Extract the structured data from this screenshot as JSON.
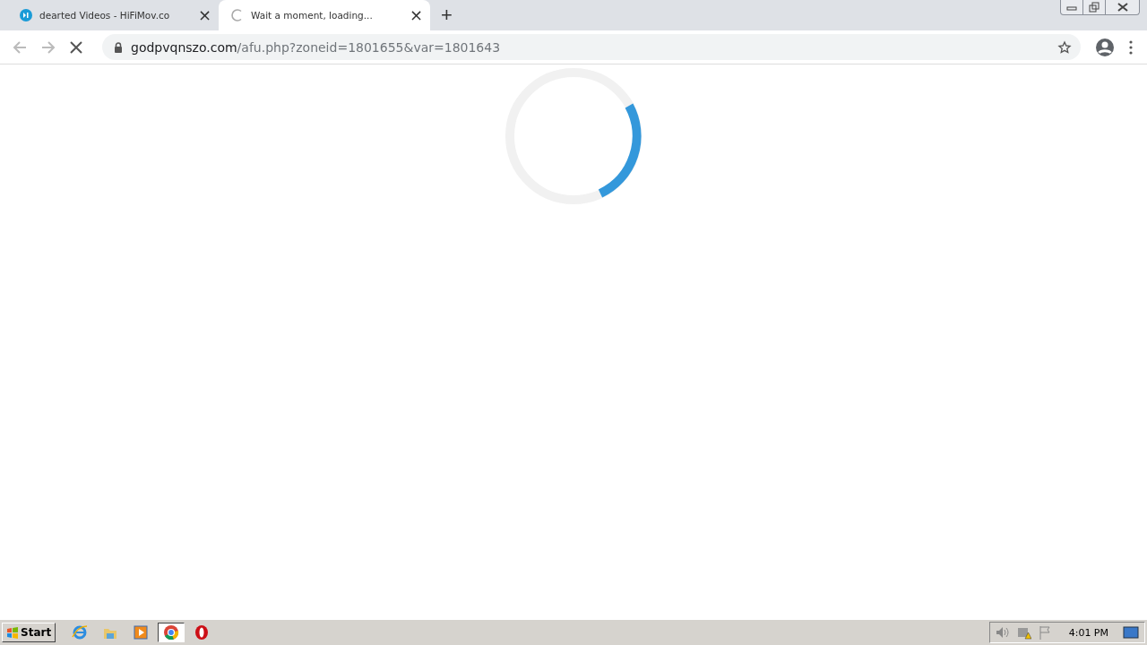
{
  "tabs": [
    {
      "title": "dearted Videos - HiFiMov.co",
      "selected": false,
      "kind": "site",
      "close": "×"
    },
    {
      "title": "Wait a moment, loading...",
      "selected": true,
      "kind": "loading",
      "close": "×"
    }
  ],
  "new_tab": "+",
  "address_bar": {
    "host": "godpvqnszo.com",
    "path": "/afu.php?zoneid=1801655&var=1801643"
  },
  "taskbar": {
    "start": "Start",
    "apps": [
      {
        "kind": "ie",
        "selected": false
      },
      {
        "kind": "folder",
        "selected": false
      },
      {
        "kind": "media",
        "selected": false
      },
      {
        "kind": "chrome",
        "selected": true
      },
      {
        "kind": "opera",
        "selected": false
      }
    ],
    "clock": "4:01 PM"
  }
}
